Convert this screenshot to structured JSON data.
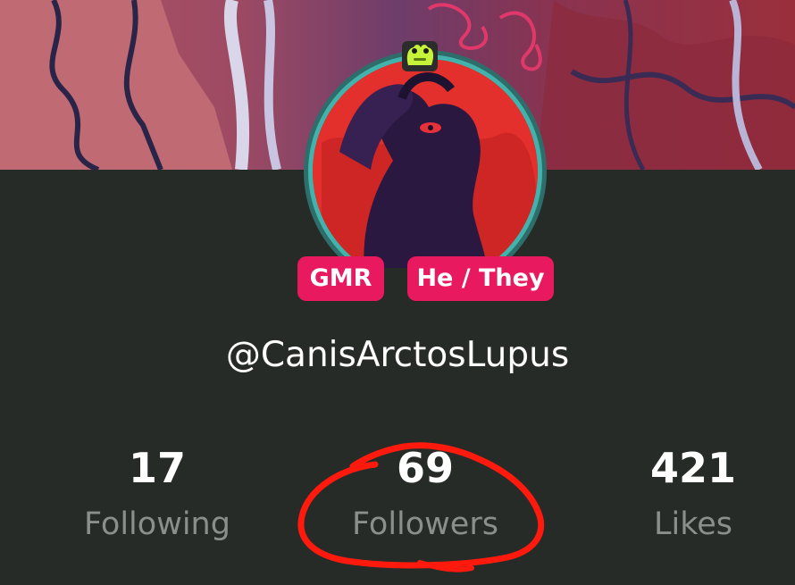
{
  "profile": {
    "tags": [
      "GMR",
      "He / They"
    ],
    "username": "@CanisArctosLupus"
  },
  "stats": {
    "following": {
      "count": "17",
      "label": "Following"
    },
    "followers": {
      "count": "69",
      "label": "Followers"
    },
    "likes": {
      "count": "421",
      "label": "Likes"
    }
  },
  "colors": {
    "background": "#262b28",
    "tag_background": "#e8195f",
    "avatar_ring": "#3ea9a3",
    "annotation": "#ff1a0d"
  },
  "icons": {
    "avatar_badge": "frog-badge-icon"
  }
}
